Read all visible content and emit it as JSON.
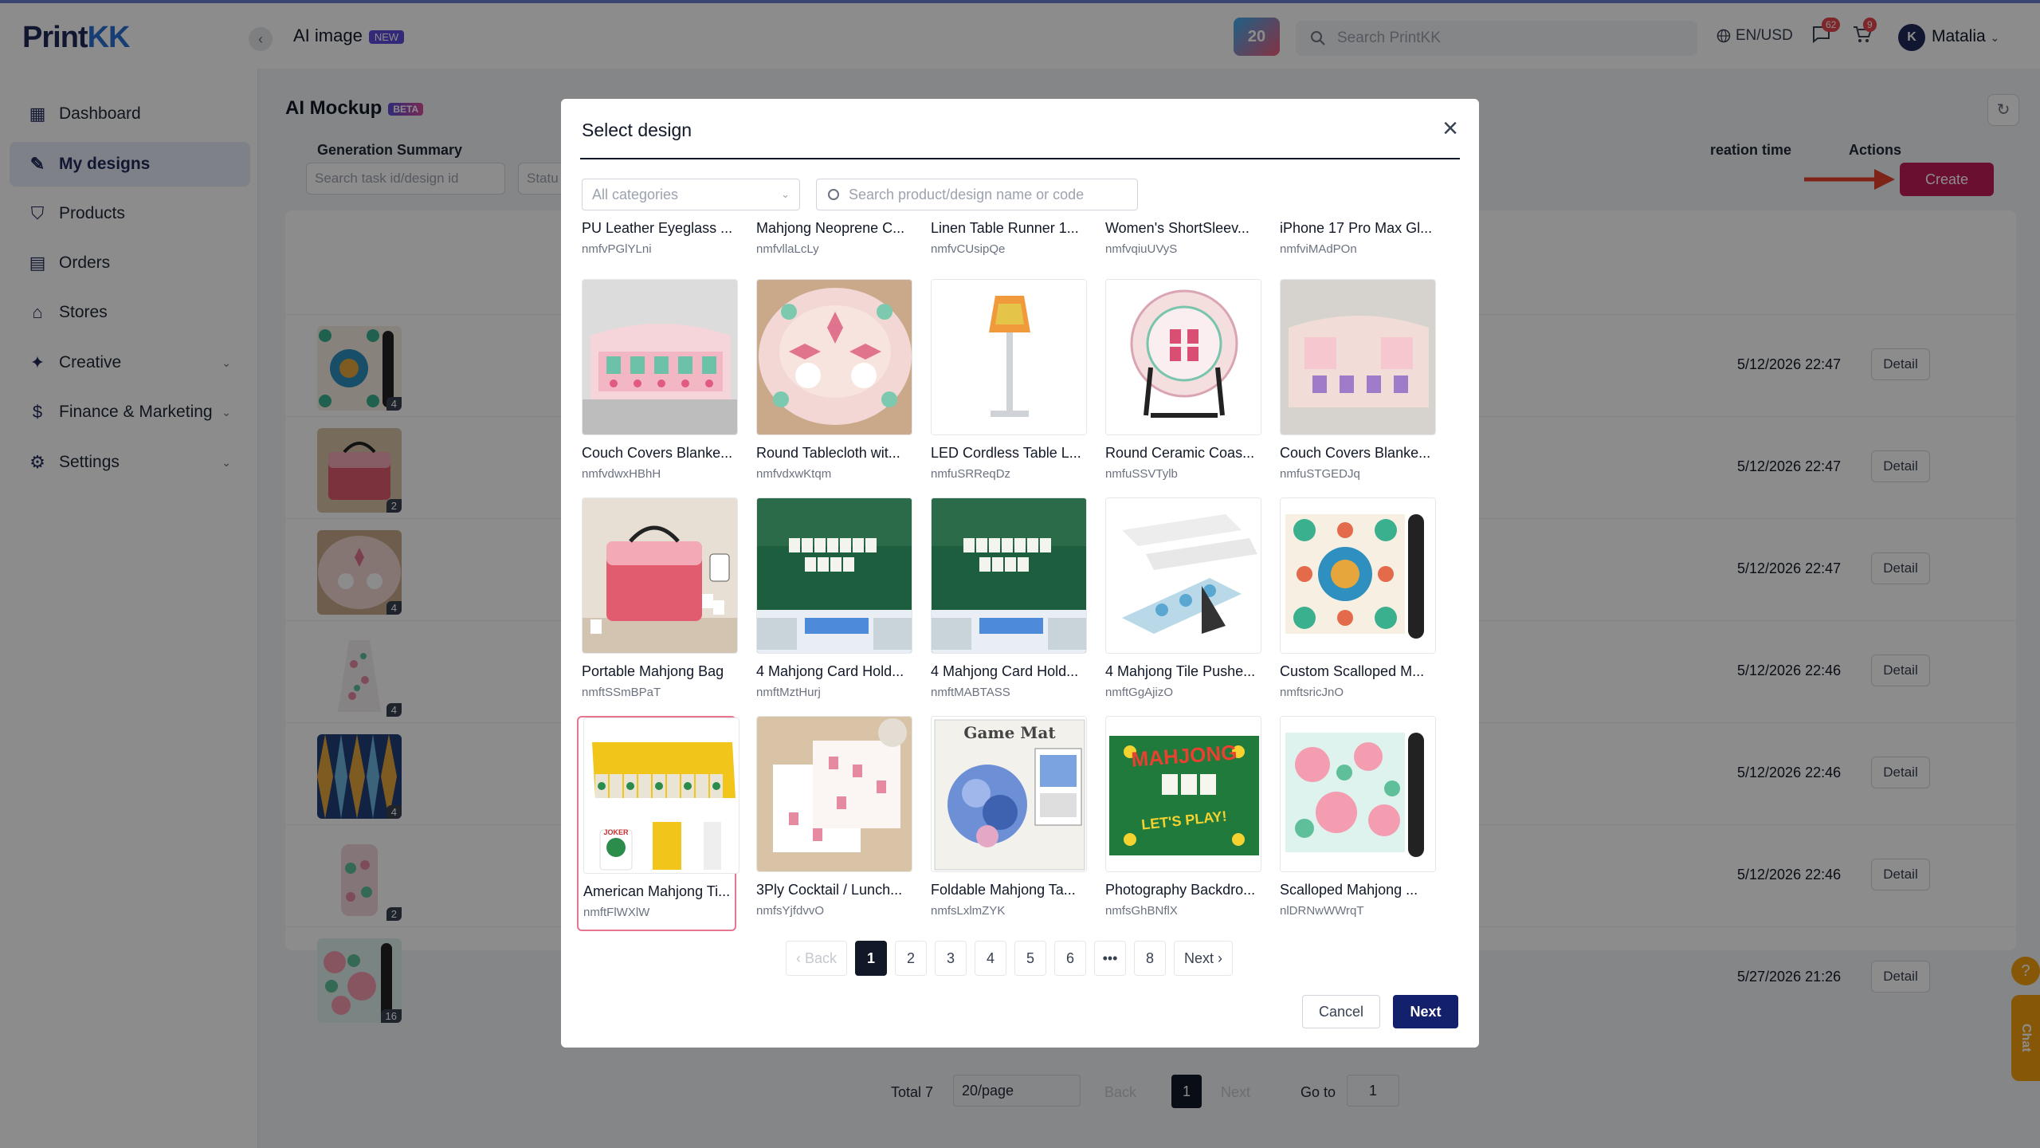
{
  "header": {
    "logo": "PrintKK",
    "ai_image": "AI image",
    "ai_image_badge": "NEW",
    "promo": "20",
    "search_placeholder": "Search PrintKK",
    "lang": "EN/USD",
    "msg_count": "62",
    "cart_count": "9",
    "user_initial": "K",
    "user_name": "Matalia"
  },
  "sidebar": {
    "items": [
      {
        "label": "Dashboard",
        "icon": "dashboard-icon"
      },
      {
        "label": "My designs",
        "icon": "designs-icon"
      },
      {
        "label": "Products",
        "icon": "shirt-icon"
      },
      {
        "label": "Orders",
        "icon": "orders-icon"
      },
      {
        "label": "Stores",
        "icon": "store-icon"
      },
      {
        "label": "Creative",
        "icon": "creative-icon"
      },
      {
        "label": "Finance & Marketing",
        "icon": "finance-icon"
      },
      {
        "label": "Settings",
        "icon": "gear-icon"
      }
    ]
  },
  "page": {
    "title": "AI Mockup",
    "title_badge": "BETA",
    "task_search_placeholder": "Search task id/design id",
    "status_placeholder": "Statu",
    "create_label": "Create",
    "col_summary": "Generation Summary",
    "col_time": "reation time",
    "col_actions": "Actions",
    "detail_label": "Detail",
    "rows": [
      {
        "count": "4",
        "time": "5/12/2026 22:47"
      },
      {
        "count": "2",
        "time": "5/12/2026 22:47"
      },
      {
        "count": "4",
        "time": "5/12/2026 22:47"
      },
      {
        "count": "4",
        "time": "5/12/2026 22:46"
      },
      {
        "count": "4",
        "time": "5/12/2026 22:46"
      },
      {
        "count": "2",
        "time": "5/12/2026 22:46"
      },
      {
        "count": "16",
        "time": "5/27/2026 21:26"
      }
    ],
    "pager": {
      "total": "Total 7",
      "per_page": "20/page",
      "back": "Back",
      "current": "1",
      "next": "Next",
      "goto_label": "Go to",
      "goto_value": "1"
    },
    "chat_label": "Chat"
  },
  "modal": {
    "title": "Select design",
    "category_placeholder": "All categories",
    "search_placeholder": "Search product/design name or code",
    "top_strip": [
      {
        "name": "PU Leather Eyeglass ...",
        "code": "nmfvPGlYLni"
      },
      {
        "name": "Mahjong Neoprene C...",
        "code": "nmfvllaLcLy"
      },
      {
        "name": "Linen Table Runner 1...",
        "code": "nmfvCUsipQe"
      },
      {
        "name": "Women's ShortSleev...",
        "code": "nmfvqiuUVyS"
      },
      {
        "name": "iPhone 17 Pro Max Gl...",
        "code": "nmfviMAdPOn"
      }
    ],
    "designs": [
      {
        "name": "Couch Covers Blanke...",
        "code": "nmfvdwxHBhH"
      },
      {
        "name": "Round Tablecloth wit...",
        "code": "nmfvdxwKtqm"
      },
      {
        "name": "LED Cordless Table L...",
        "code": "nmfuSRReqDz"
      },
      {
        "name": "Round Ceramic Coas...",
        "code": "nmfuSSVTylb"
      },
      {
        "name": "Couch Covers Blanke...",
        "code": "nmfuSTGEDJq"
      },
      {
        "name": "Portable Mahjong Bag",
        "code": "nmftSSmBPaT"
      },
      {
        "name": "4 Mahjong Card Hold...",
        "code": "nmftMztHurj"
      },
      {
        "name": "4 Mahjong Card Hold...",
        "code": "nmftMABTASS"
      },
      {
        "name": "4 Mahjong Tile Pushe...",
        "code": "nmftGgAjizO"
      },
      {
        "name": "Custom Scalloped M...",
        "code": "nmftsricJnO"
      },
      {
        "name": "American Mahjong Ti...",
        "code": "nmftFlWXlW"
      },
      {
        "name": "3Ply Cocktail / Lunch...",
        "code": "nmfsYjfdvvO"
      },
      {
        "name": "Foldable Mahjong Ta...",
        "code": "nmfsLxlmZYK"
      },
      {
        "name": "Photography Backdro...",
        "code": "nmfsGhBNflX"
      },
      {
        "name": "Scalloped Mahjong ...",
        "code": "nlDRNwWWrqT"
      }
    ],
    "game_mat_text": "Game Mat",
    "mahjong_text": "MAHJONG",
    "lets_play_text": "LET'S PLAY!",
    "joker_text": "JOKER",
    "pagination": {
      "back": "Back",
      "pages": [
        "1",
        "2",
        "3",
        "4",
        "5",
        "6"
      ],
      "ellipsis": "•••",
      "last": "8",
      "next": "Next"
    },
    "cancel_label": "Cancel",
    "next_label": "Next"
  }
}
